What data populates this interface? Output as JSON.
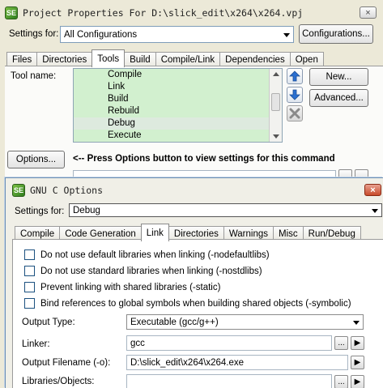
{
  "outer": {
    "title": "Project Properties For D:\\slick_edit\\x264\\x264.vpj",
    "close": "×",
    "settings_label": "Settings for:",
    "settings_value": "All Configurations",
    "configurations_button": "Configurations...",
    "tabs": [
      {
        "label": "Files"
      },
      {
        "label": "Directories"
      },
      {
        "label": "Tools"
      },
      {
        "label": "Build"
      },
      {
        "label": "Compile/Link"
      },
      {
        "label": "Dependencies"
      },
      {
        "label": "Open"
      }
    ],
    "tool_name_label": "Tool name:",
    "tools": [
      "Compile",
      "Link",
      "Build",
      "Rebuild",
      "Debug",
      "Execute"
    ],
    "new_button": "New...",
    "advanced_button": "Advanced...",
    "options_button": "Options...",
    "options_hint": "<-- Press Options button to view settings for this command"
  },
  "inner": {
    "title": "GNU C Options",
    "close": "×",
    "settings_label": "Settings for:",
    "settings_value": "Debug",
    "tabs": [
      {
        "label": "Compile"
      },
      {
        "label": "Code Generation"
      },
      {
        "label": "Link"
      },
      {
        "label": "Directories"
      },
      {
        "label": "Warnings"
      },
      {
        "label": "Misc"
      },
      {
        "label": "Run/Debug"
      }
    ],
    "checkboxes": [
      "Do not use default libraries when linking (-nodefaultlibs)",
      "Do not use standard libraries when linking (-nostdlibs)",
      "Prevent linking with shared libraries (-static)",
      "Bind references to global symbols when building shared objects (-symbolic)"
    ],
    "output_type_label": "Output Type:",
    "output_type_value": "Executable (gcc/g++)",
    "linker_label": "Linker:",
    "linker_value": "gcc",
    "output_filename_label": "Output Filename (-o):",
    "output_filename_value": "D:\\slick_edit\\x264\\x264.exe",
    "libraries_label": "Libraries/Objects:",
    "browse": "...",
    "menu": "▶"
  },
  "colors": {
    "tool_list_bg": "#d2f0cf",
    "dialog_bg": "#ece9d8"
  }
}
